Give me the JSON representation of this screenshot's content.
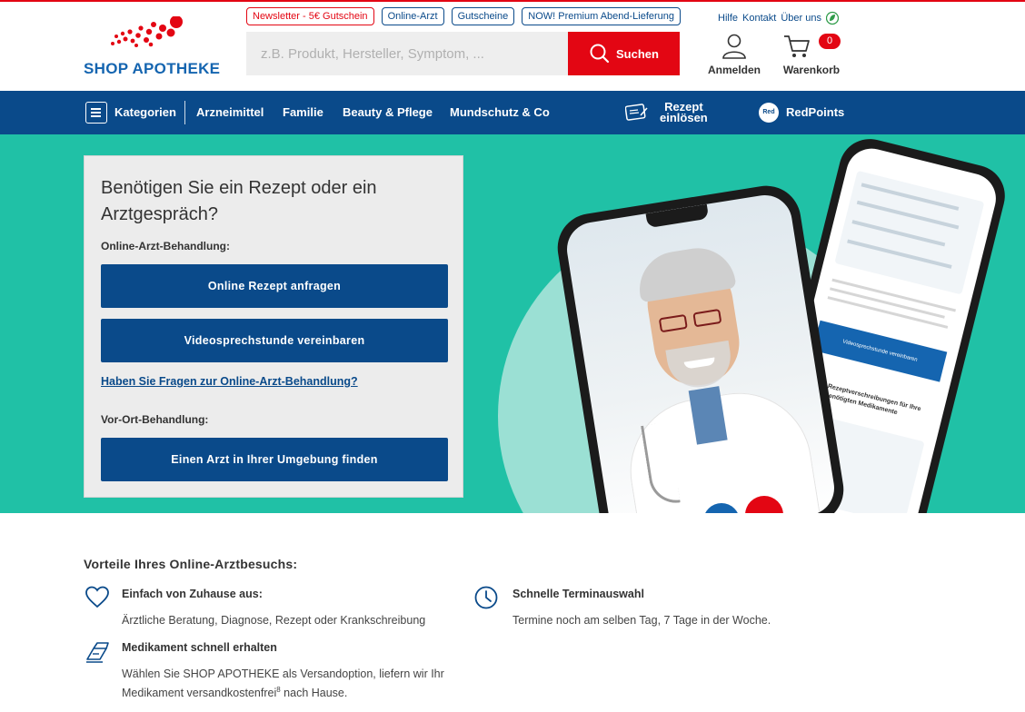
{
  "brand": {
    "name": "SHOP APOTHEKE"
  },
  "promos": [
    "Newsletter - 5€ Gutschein",
    "Online-Arzt",
    "Gutscheine",
    "NOW! Premium Abend-Lieferung"
  ],
  "search": {
    "placeholder": "z.B. Produkt, Hersteller, Symptom, ...",
    "button_label": "Suchen"
  },
  "util_links": {
    "help": "Hilfe",
    "contact": "Kontakt",
    "about": "Über uns"
  },
  "account": {
    "label": "Anmelden"
  },
  "cart": {
    "label": "Warenkorb",
    "count": "0"
  },
  "nav": {
    "categories": "Kategorien",
    "items": [
      "Arzneimittel",
      "Familie",
      "Beauty & Pflege",
      "Mundschutz & Co"
    ],
    "prescription_line1": "Rezept",
    "prescription_line2": "einlösen",
    "redpoints_badge": "Red",
    "redpoints": "RedPoints"
  },
  "hero": {
    "title": "Benötigen Sie ein Rezept oder ein Arztgespräch?",
    "online_label": "Online-Arzt-Behandlung:",
    "btn_request": "Online Rezept anfragen",
    "btn_video": "Videosprechstunde vereinbaren",
    "faq_link": "Haben Sie Fragen zur Online-Arzt-Behandlung?",
    "local_label": "Vor-Ort-Behandlung:",
    "btn_local": "Einen Arzt in Ihrer Umgebung finden"
  },
  "phone_screen": {
    "cta": "Videosprechstunde vereinbaren",
    "heading": "Online Rezeptverschreibungen für Ihre häufig benötigten Medikamente"
  },
  "benefits": {
    "heading": "Vorteile Ihres Online-Arztbesuchs:",
    "items": [
      {
        "icon": "heart-icon",
        "title": "Einfach von Zuhause aus:",
        "text": "Ärztliche Beratung, Diagnose, Rezept oder Krankschreibung"
      },
      {
        "icon": "clock-icon",
        "title": "Schnelle Terminauswahl",
        "text": "Termine noch am selben Tag, 7 Tage in der Woche."
      },
      {
        "icon": "delivery-box-icon",
        "title": "Medikament schnell erhalten",
        "text": "Wählen Sie SHOP APOTHEKE als Versandoption, liefern wir Ihr",
        "text2": "Medikament versandkostenfrei",
        "footnote": "8",
        "text3": " nach Hause."
      }
    ]
  },
  "colors": {
    "brand_blue": "#0a4a8a",
    "brand_red": "#e30613",
    "hero_teal": "#20c1a6"
  }
}
